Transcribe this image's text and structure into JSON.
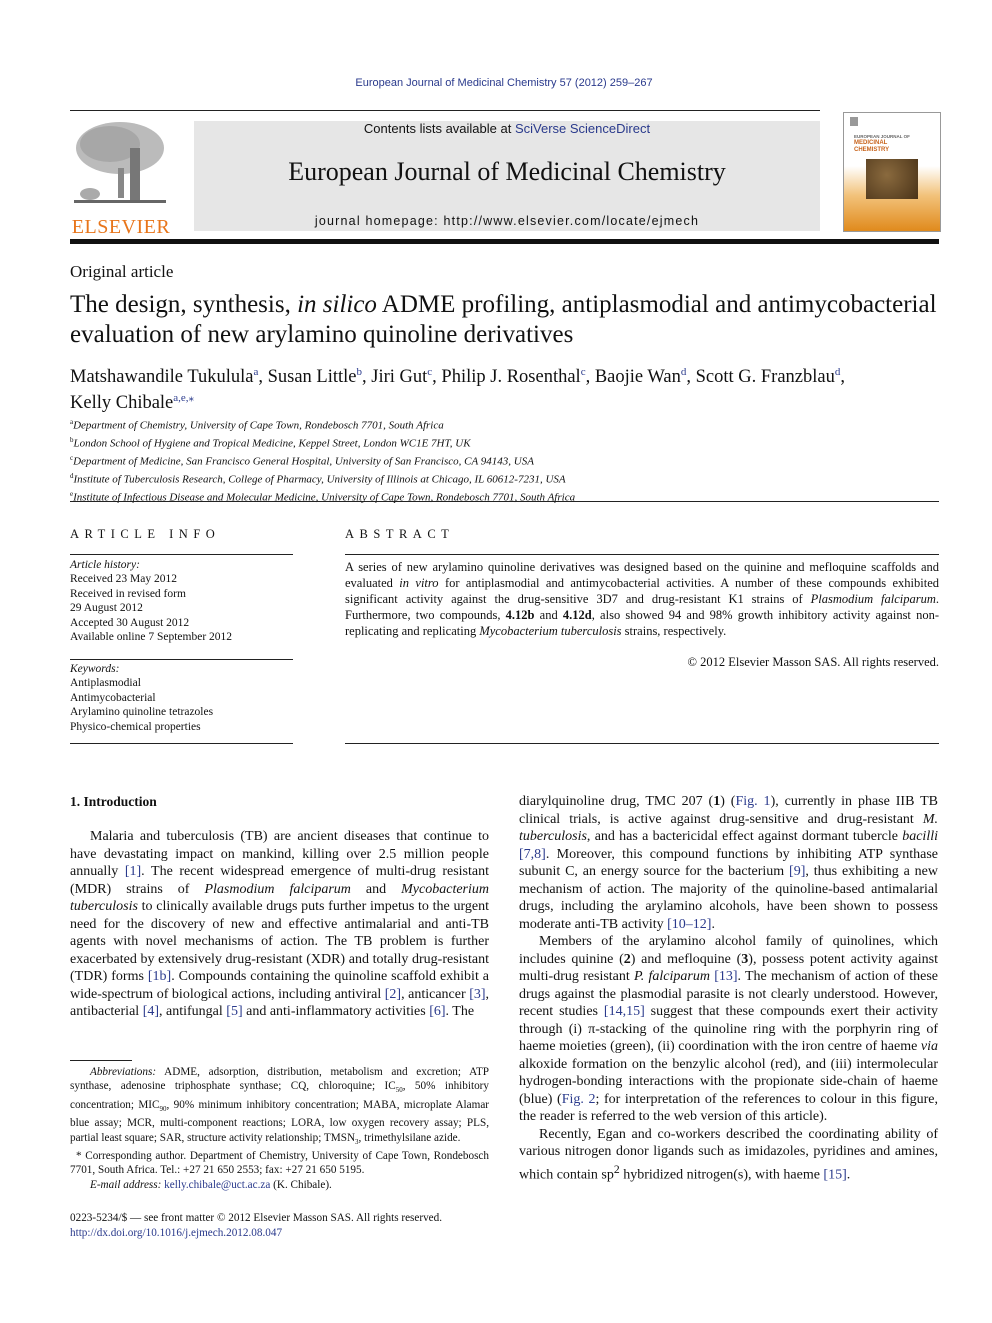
{
  "header": {
    "citation": "European Journal of Medicinal Chemistry 57 (2012) 259–267",
    "publisher_logo_text": "ELSEVIER",
    "contents_prefix": "Contents lists available at ",
    "contents_link": "SciVerse ScienceDirect",
    "journal_title": "European Journal of Medicinal Chemistry",
    "homepage": "journal homepage: http://www.elsevier.com/locate/ejmech",
    "cover_title_line1": "EUROPEAN JOURNAL OF",
    "cover_title_line2": "MEDICINAL",
    "cover_title_line3": "CHEMISTRY",
    "accent_color": "#e8751a",
    "link_color": "#2a3a8c"
  },
  "article": {
    "type": "Original article",
    "title_part1": "The design, synthesis, ",
    "title_italic": "in silico",
    "title_part2": " ADME profiling, antiplasmodial and antimycobacterial evaluation of new arylamino quinoline derivatives",
    "authors": [
      {
        "name": "Matshawandile Tukulula",
        "sup": "a"
      },
      {
        "name": "Susan Little",
        "sup": "b"
      },
      {
        "name": "Jiri Gut",
        "sup": "c"
      },
      {
        "name": "Philip J. Rosenthal",
        "sup": "c"
      },
      {
        "name": "Baojie Wan",
        "sup": "d"
      },
      {
        "name": "Scott G. Franzblau",
        "sup": "d"
      },
      {
        "name": "Kelly Chibale",
        "sup": "a,e,⁎"
      }
    ],
    "affiliations": [
      {
        "sup": "a",
        "text": "Department of Chemistry, University of Cape Town, Rondebosch 7701, South Africa"
      },
      {
        "sup": "b",
        "text": "London School of Hygiene and Tropical Medicine, Keppel Street, London WC1E 7HT, UK"
      },
      {
        "sup": "c",
        "text": "Department of Medicine, San Francisco General Hospital, University of San Francisco, CA 94143, USA"
      },
      {
        "sup": "d",
        "text": "Institute of Tuberculosis Research, College of Pharmacy, University of Illinois at Chicago, IL 60612-7231, USA"
      },
      {
        "sup": "e",
        "text": "Institute of Infectious Disease and Molecular Medicine, University of Cape Town, Rondebosch 7701, South Africa"
      }
    ]
  },
  "article_info": {
    "heading": "ARTICLE INFO",
    "history_label": "Article history:",
    "history": [
      "Received 23 May 2012",
      "Received in revised form",
      "29 August 2012",
      "Accepted 30 August 2012",
      "Available online 7 September 2012"
    ],
    "keywords_label": "Keywords:",
    "keywords": [
      "Antiplasmodial",
      "Antimycobacterial",
      "Arylamino quinoline tetrazoles",
      "Physico-chemical properties"
    ]
  },
  "abstract": {
    "heading": "ABSTRACT",
    "s1": "A series of new arylamino quinoline derivatives was designed based on the quinine and mefloquine scaffolds and evaluated ",
    "s1_it": "in vitro",
    "s2": " for antiplasmodial and antimycobacterial activities. A number of these compounds exhibited significant activity against the drug-sensitive 3D7 and drug-resistant K1 strains of ",
    "s2_it": "Plasmodium falciparum",
    "s3": ". Furthermore, two compounds, ",
    "c1": "4.12b",
    "s4": " and ",
    "c2": "4.12d",
    "s5": ", also showed 94 and 98% growth inhibitory activity against non-replicating and replicating ",
    "s5_it": "Mycobacterium tuberculosis",
    "s6": " strains, respectively.",
    "copyright": "© 2012 Elsevier Masson SAS. All rights reserved."
  },
  "intro": {
    "heading": "1.  Introduction",
    "p1": [
      {
        "t": "Malaria and tuberculosis (TB) are ancient diseases that continue to have devastating impact on mankind, killing over 2.5 million people annually "
      },
      {
        "t": "[1]",
        "link": true
      },
      {
        "t": ". The recent widespread emergence of multi-drug resistant (MDR) strains of "
      },
      {
        "t": "Plasmodium falciparum",
        "it": true
      },
      {
        "t": " and "
      },
      {
        "t": "Mycobacterium tuberculosis",
        "it": true
      },
      {
        "t": " to clinically available drugs puts further impetus to the urgent need for the discovery of new and effective antimalarial and anti-TB agents with novel mechanisms of action. The TB problem is further exacerbated by extensively drug-resistant (XDR) and totally drug-resistant (TDR) forms "
      },
      {
        "t": "[1b]",
        "link": true
      },
      {
        "t": ". Compounds containing the quinoline scaffold exhibit a wide-spectrum of biological actions, including antiviral "
      },
      {
        "t": "[2]",
        "link": true
      },
      {
        "t": ", anticancer "
      },
      {
        "t": "[3]",
        "link": true
      },
      {
        "t": ", antibacterial "
      },
      {
        "t": "[4]",
        "link": true
      },
      {
        "t": ", antifungal "
      },
      {
        "t": "[5]",
        "link": true
      },
      {
        "t": " and anti-inflammatory activities "
      },
      {
        "t": "[6]",
        "link": true
      },
      {
        "t": ". The"
      }
    ],
    "p1_cont": [
      {
        "t": "diarylquinoline drug, TMC 207 ("
      },
      {
        "t": "1",
        "b": true
      },
      {
        "t": ") ("
      },
      {
        "t": "Fig. 1",
        "link": true
      },
      {
        "t": "), currently in phase IIB TB clinical trials, is active against drug-sensitive and drug-resistant "
      },
      {
        "t": "M. tuberculosis",
        "it": true
      },
      {
        "t": ", and has a bactericidal effect against dormant tubercle "
      },
      {
        "t": "bacilli",
        "it": true
      },
      {
        "t": " "
      },
      {
        "t": "[7,8]",
        "link": true
      },
      {
        "t": ". Moreover, this compound functions by inhibiting ATP synthase subunit C, an energy source for the bacterium "
      },
      {
        "t": "[9]",
        "link": true
      },
      {
        "t": ", thus exhibiting a new mechanism of action. The majority of the quinoline-based antimalarial drugs, including the arylamino alcohols, have been shown to possess moderate anti-TB activity "
      },
      {
        "t": "[10–12]",
        "link": true
      },
      {
        "t": "."
      }
    ],
    "p2": [
      {
        "t": "Members of the arylamino alcohol family of quinolines, which includes quinine ("
      },
      {
        "t": "2",
        "b": true
      },
      {
        "t": ") and mefloquine ("
      },
      {
        "t": "3",
        "b": true
      },
      {
        "t": "), possess potent activity against multi-drug resistant "
      },
      {
        "t": "P. falciparum",
        "it": true
      },
      {
        "t": " "
      },
      {
        "t": "[13]",
        "link": true
      },
      {
        "t": ". The mechanism of action of these drugs against the plasmodial parasite is not clearly understood. However, recent studies "
      },
      {
        "t": "[14,15]",
        "link": true
      },
      {
        "t": " suggest that these compounds exert their activity through (i) π-stacking of the quinoline ring with the porphyrin ring of haeme moieties (green), (ii) coordination with the iron centre of haeme "
      },
      {
        "t": "via",
        "it": true
      },
      {
        "t": " alkoxide formation on the benzylic alcohol (red), and (iii) intermolecular hydrogen-bonding interactions with the propionate side-chain of haeme (blue) ("
      },
      {
        "t": "Fig. 2",
        "link": true
      },
      {
        "t": "; for interpretation of the references to colour in this figure, the reader is referred to the web version of this article)."
      }
    ],
    "p3": [
      {
        "t": "Recently, Egan and co-workers described the coordinating ability of various nitrogen donor ligands such as imidazoles, pyridines and amines, which contain sp"
      },
      {
        "t": "2",
        "sup": true
      },
      {
        "t": " hybridized nitrogen(s), with haeme "
      },
      {
        "t": "[15]",
        "link": true
      },
      {
        "t": "."
      }
    ]
  },
  "footnotes": {
    "abbrev_label": "Abbreviations:",
    "abbrev": [
      {
        "t": " ADME, adsorption, distribution, metabolism and excretion; ATP synthase, adenosine triphosphate synthase; CQ, chloroquine; IC"
      },
      {
        "t": "50",
        "sub": true
      },
      {
        "t": ", 50% inhibitory concentration; MIC"
      },
      {
        "t": "90",
        "sub": true
      },
      {
        "t": ", 90% minimum inhibitory concentration; MABA, microplate Alamar blue assay; MCR, multi-component reactions; LORA, low oxygen recovery assay; PLS, partial least square; SAR, structure activity relationship; TMSN"
      },
      {
        "t": "3",
        "sub": true
      },
      {
        "t": ", trimethylsilane azide."
      }
    ],
    "corresponding": "* Corresponding author. Department of Chemistry, University of Cape Town, Rondebosch 7701, South Africa. Tel.: +27 21 650 2553; fax: +27 21 650 5195.",
    "email_label": "E-mail address:",
    "email": "kelly.chibale@uct.ac.za",
    "email_suffix": " (K. Chibale).",
    "front_matter": "0223-5234/$ — see front matter © 2012 Elsevier Masson SAS. All rights reserved.",
    "doi": "http://dx.doi.org/10.1016/j.ejmech.2012.08.047"
  }
}
